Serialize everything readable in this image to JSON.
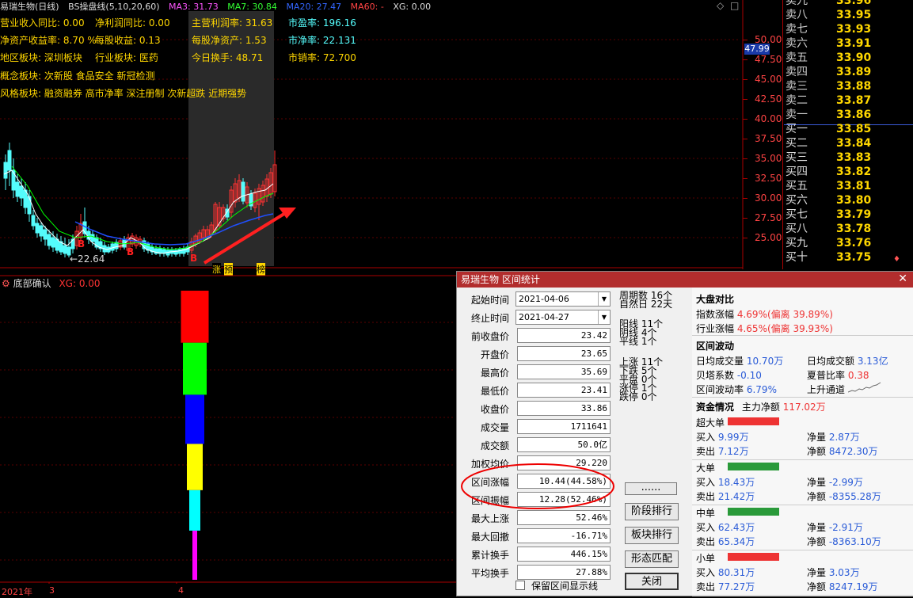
{
  "chart": {
    "stock_name": "易瑞生物(日线)",
    "indicator": "BS操盘线(5,10,20,60)",
    "ma3": "MA3: 31.73",
    "ma7": "MA7: 30.84",
    "ma20": "MA20: 27.47",
    "ma60": "MA60: -",
    "xg": "XG: 0.00",
    "fin": {
      "rev_yoy": "营业收入同比: 0.00",
      "np_yoy": "净利润同比: 0.00",
      "main_margin": "主营利润率: 31.63",
      "pe": "市盈率: 196.16",
      "roe": "净资产收益率: 8.70 %",
      "eps": "每股收益: 0.13",
      "bvps": "每股净资产: 1.53",
      "pb": "市净率: 22.131",
      "region": "地区板块: 深圳板块",
      "industry": "行业板块: 医药",
      "turnover": "今日换手: 48.71",
      "ps": "市销率: 72.700",
      "concept": "概念板块: 次新股 食品安全 新冠检测",
      "style": "风格板块: 融资融券 高市净率 深注册制 次新超跌 近期强势"
    },
    "low_label": "←22.64",
    "markers": [
      "涨",
      "预",
      "榜"
    ],
    "yaxis": [
      "50.00",
      "47.50",
      "45.00",
      "42.50",
      "40.00",
      "37.50",
      "35.00",
      "32.50",
      "30.00",
      "27.50",
      "25.00"
    ],
    "current_price_tag": "47.99",
    "sub_title": "底部确认",
    "sub_xg": "XG: 0.00",
    "xaxis": [
      "2021年",
      "3",
      "4"
    ],
    "bottom_bars": [
      {
        "color": "#ff0000",
        "value": 1.0
      },
      {
        "color": "#00ff00",
        "value": 0.82
      },
      {
        "color": "#0000ff",
        "value": 0.64
      },
      {
        "color": "#ffff00",
        "value": 0.47
      },
      {
        "color": "#00ffff",
        "value": 0.31
      },
      {
        "color": "#ff00ff",
        "value": 0.17
      }
    ]
  },
  "quotes": [
    {
      "label": "卖九",
      "value": "33.96"
    },
    {
      "label": "卖八",
      "value": "33.95"
    },
    {
      "label": "卖七",
      "value": "33.93"
    },
    {
      "label": "卖六",
      "value": "33.91"
    },
    {
      "label": "卖五",
      "value": "33.90"
    },
    {
      "label": "卖四",
      "value": "33.89"
    },
    {
      "label": "卖三",
      "value": "33.88"
    },
    {
      "label": "卖二",
      "value": "33.87"
    },
    {
      "label": "卖一",
      "value": "33.86"
    },
    {
      "label": "买一",
      "value": "33.85"
    },
    {
      "label": "买二",
      "value": "33.84"
    },
    {
      "label": "买三",
      "value": "33.83"
    },
    {
      "label": "买四",
      "value": "33.82"
    },
    {
      "label": "买五",
      "value": "33.81"
    },
    {
      "label": "买六",
      "value": "33.80"
    },
    {
      "label": "买七",
      "value": "33.79"
    },
    {
      "label": "买八",
      "value": "33.78"
    },
    {
      "label": "买九",
      "value": "33.76"
    },
    {
      "label": "买十",
      "value": "33.75"
    }
  ],
  "dialog": {
    "title": "易瑞生物 区间统计",
    "start_label": "起始时间",
    "start_value": "2021-04-06",
    "end_label": "终止时间",
    "end_value": "2021-04-27",
    "fields": [
      {
        "label": "前收盘价",
        "value": "23.42"
      },
      {
        "label": "开盘价",
        "value": "23.65"
      },
      {
        "label": "最高价",
        "value": "35.69"
      },
      {
        "label": "最低价",
        "value": "23.41"
      },
      {
        "label": "收盘价",
        "value": "33.86"
      },
      {
        "label": "成交量",
        "value": "1711641"
      },
      {
        "label": "成交额",
        "value": "50.0亿"
      },
      {
        "label": "加权均价",
        "value": "29.220"
      },
      {
        "label": "区间涨幅",
        "value": "10.44(44.58%)"
      },
      {
        "label": "区间振幅",
        "value": "12.28(52.46%)"
      },
      {
        "label": "最大上涨",
        "value": "52.46%"
      },
      {
        "label": "最大回撤",
        "value": "-16.71%"
      },
      {
        "label": "累计换手",
        "value": "446.15%"
      },
      {
        "label": "平均换手",
        "value": "27.88%"
      }
    ],
    "checkbox_label": "保留区间显示线",
    "period_stats": [
      {
        "label": "周期数",
        "value": "16个"
      },
      {
        "label": "自然日",
        "value": "22天"
      }
    ],
    "candle_stats": [
      {
        "label": "阳线",
        "value": "11个"
      },
      {
        "label": "阴线",
        "value": "4个"
      },
      {
        "label": "平线",
        "value": "1个"
      }
    ],
    "move_stats": [
      {
        "label": "上涨",
        "value": "11个"
      },
      {
        "label": "下跌",
        "value": "5个"
      },
      {
        "label": "平盘",
        "value": "0个"
      },
      {
        "label": "涨停",
        "value": "1个"
      },
      {
        "label": "跌停",
        "value": "0个"
      }
    ],
    "buttons": {
      "dots": "......",
      "stage_rank": "阶段排行",
      "sector_rank": "板块排行",
      "pattern": "形态匹配",
      "close": "关闭"
    },
    "market": {
      "title": "大盘对比",
      "index_label": "指数涨幅",
      "index_value": "4.69%",
      "index_dev": "(偏离 39.89%)",
      "ind_label": "行业涨幅",
      "ind_value": "4.65%",
      "ind_dev": "(偏离 39.93%)"
    },
    "volatility": {
      "title": "区间波动",
      "avg_vol_label": "日均成交量",
      "avg_vol": "10.70万",
      "avg_amt_label": "日均成交额",
      "avg_amt": "3.13亿",
      "beta_label": "贝塔系数",
      "beta": "-0.10",
      "sharpe_label": "夏普比率",
      "sharpe": "0.38",
      "vol_rate_label": "区间波动率",
      "vol_rate": "6.79%",
      "channel": "上升通道"
    },
    "funds": {
      "title": "资金情况",
      "main_label": "主力净额",
      "main_value": "117.02万",
      "groups": [
        {
          "name": "超大单",
          "color": "#e33",
          "buy": "9.99万",
          "sell": "7.12万",
          "net_vol": "2.87万",
          "net_amt": "8472.30万"
        },
        {
          "name": "大单",
          "color": "#2a9a3a",
          "buy": "18.43万",
          "sell": "21.42万",
          "net_vol": "-2.99万",
          "net_amt": "-8355.28万"
        },
        {
          "name": "中单",
          "color": "#2a9a3a",
          "buy": "62.43万",
          "sell": "65.34万",
          "net_vol": "-2.91万",
          "net_amt": "-8363.10万"
        },
        {
          "name": "小单",
          "color": "#e33",
          "buy": "80.31万",
          "sell": "77.27万",
          "net_vol": "3.03万",
          "net_amt": "8247.19万"
        }
      ],
      "buy_label": "买入",
      "sell_label": "卖出",
      "netvol_label": "净量",
      "netamt_label": "净额"
    }
  }
}
